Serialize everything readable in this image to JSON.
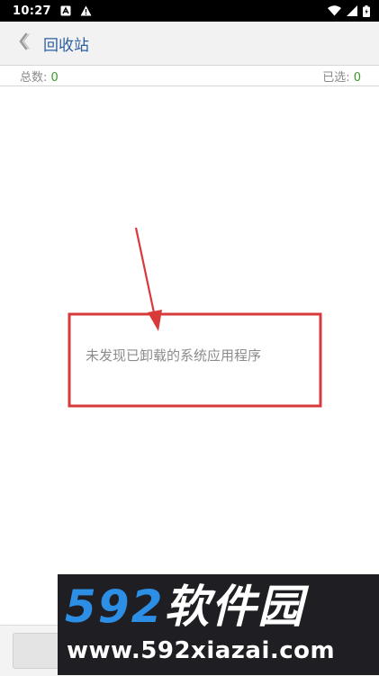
{
  "status_bar": {
    "time": "10:27",
    "icons": [
      "notification-a-icon",
      "warning-icon",
      "wifi-icon",
      "signal-icon",
      "battery-icon"
    ]
  },
  "app_bar": {
    "back_icon": "chevron-left-icon",
    "title": "回收站"
  },
  "counts": {
    "total_label": "总数:",
    "total_value": "0",
    "selected_label": "已选:",
    "selected_value": "0"
  },
  "empty_message": "未发现已卸载的系统应用程序",
  "colors": {
    "title": "#2c5fa0",
    "count_value": "#3d9a2a",
    "annotation_red": "#d83a3a",
    "watermark_blue": "#2d8ee6"
  },
  "watermark": {
    "logo_number": "592",
    "logo_text": "软件园",
    "url": "www.592xiazai.com"
  }
}
